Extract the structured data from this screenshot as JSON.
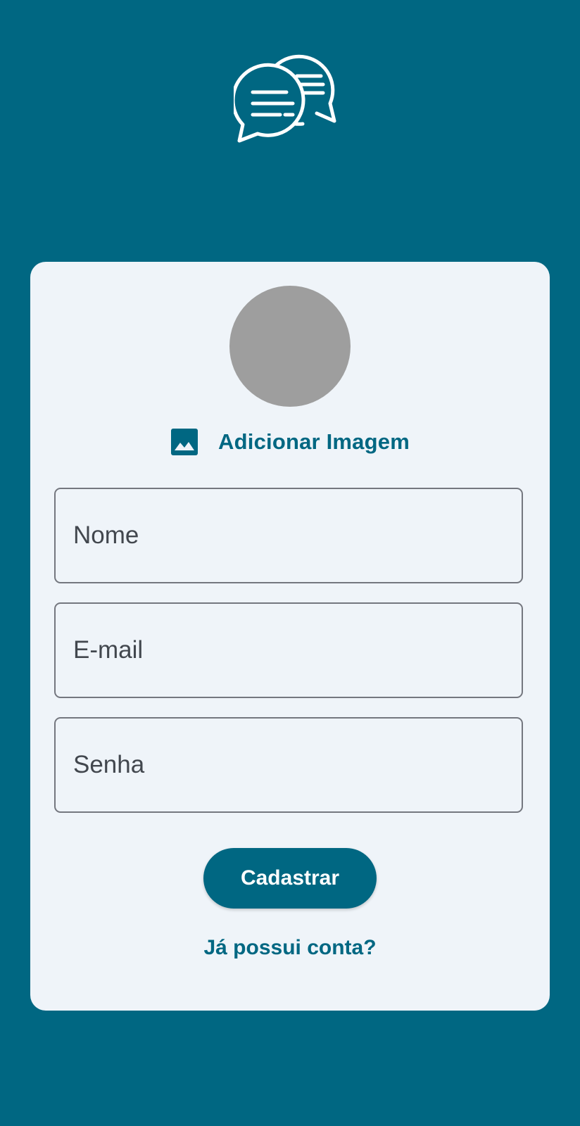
{
  "header": {
    "logo_icon": "chat-bubbles-icon"
  },
  "colors": {
    "primary": "#006782",
    "card_background": "#eff4f9",
    "avatar_placeholder": "#9e9e9e",
    "field_border": "#74777f",
    "text": "#42474e"
  },
  "form": {
    "avatar_icon": "avatar-placeholder",
    "add_image_icon": "image-icon",
    "add_image_label": "Adicionar Imagem",
    "name_placeholder": "Nome",
    "email_placeholder": "E-mail",
    "password_placeholder": "Senha",
    "submit_label": "Cadastrar",
    "login_link": "Já possui conta?"
  }
}
